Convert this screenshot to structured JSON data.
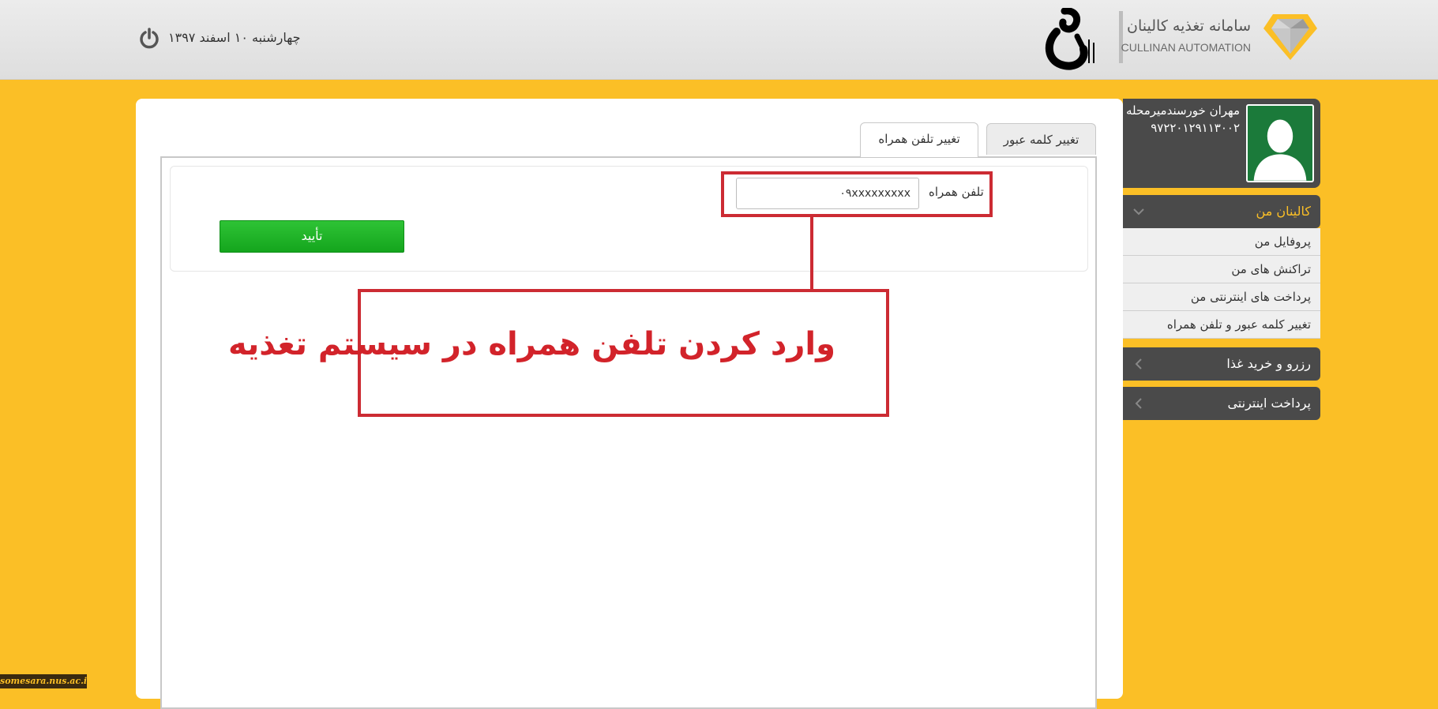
{
  "header": {
    "brand_title": "سامانه تغذیه کالینان",
    "brand_subtitle": "CULLINAN AUTOMATION",
    "date": "چهارشنبه ۱۰ اسفند ۱۳۹۷",
    "brand_color": "#fbbf26"
  },
  "tabs": [
    {
      "label": "تغییر کلمه عبور",
      "active": false
    },
    {
      "label": "تغییر تلفن همراه",
      "active": true
    }
  ],
  "form": {
    "phone_label": "تلفن همراه",
    "phone_value": "۰۹xxxxxxxxx",
    "confirm_label": "تأیید"
  },
  "annotation": {
    "text": "وارد کردن  تلفن همراه در سیستم تغذیه",
    "color": "#cc2b33"
  },
  "sidebar": {
    "user_name": "مهران خورسندمیرمحله",
    "user_id": "۹۷۲۲۰۱۲۹۱۱۳۰۰۲",
    "menus": [
      {
        "label": "کالینان من",
        "expanded": true,
        "items": [
          "پروفایل من",
          "تراکنش های من",
          "پرداخت های اینترنتی من",
          "تغییر کلمه عبور و تلفن همراه"
        ]
      },
      {
        "label": "رزرو و خرید غذا",
        "expanded": false
      },
      {
        "label": "پرداخت اینترنتی",
        "expanded": false
      }
    ]
  },
  "watermark": "somesara.nus.ac.ir"
}
